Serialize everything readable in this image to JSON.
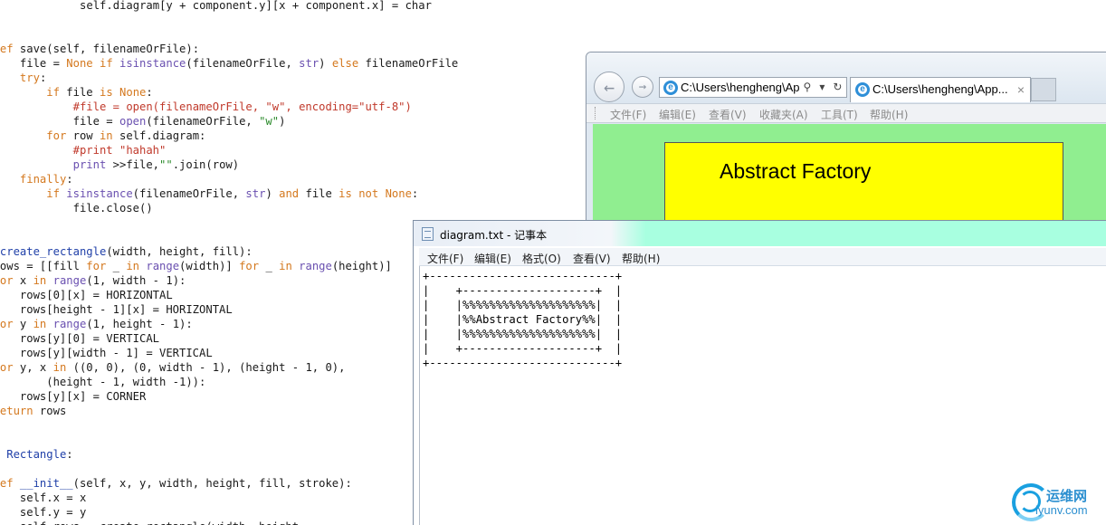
{
  "editor": {
    "lines": [
      {
        "row": 0,
        "col": 0,
        "tokens": [
          [
            "            self.diagram[y + component.y][x + component.x] = char",
            ""
          ]
        ]
      },
      {
        "row": 3,
        "col": -1,
        "tokens": [
          [
            "def",
            "tk-kw"
          ],
          [
            " save(self, filenameOrFile):",
            ""
          ]
        ]
      },
      {
        "row": 4,
        "col": -1,
        "tokens": [
          [
            "    file = ",
            ""
          ],
          [
            "None",
            "tk-kw"
          ],
          [
            " ",
            ""
          ],
          [
            "if",
            "tk-kw"
          ],
          [
            " ",
            ""
          ],
          [
            "isinstance",
            "tk-bi"
          ],
          [
            "(filenameOrFile, ",
            ""
          ],
          [
            "str",
            "tk-bi"
          ],
          [
            ") ",
            ""
          ],
          [
            "else",
            "tk-kw"
          ],
          [
            " filenameOrFile",
            ""
          ]
        ]
      },
      {
        "row": 5,
        "col": -1,
        "tokens": [
          [
            "    ",
            ""
          ],
          [
            "try",
            "tk-kw"
          ],
          [
            ":",
            ""
          ]
        ]
      },
      {
        "row": 6,
        "col": -1,
        "tokens": [
          [
            "        ",
            ""
          ],
          [
            "if",
            "tk-kw"
          ],
          [
            " file ",
            ""
          ],
          [
            "is",
            "tk-kw"
          ],
          [
            " ",
            ""
          ],
          [
            "None",
            "tk-kw"
          ],
          [
            ":",
            ""
          ]
        ]
      },
      {
        "row": 7,
        "col": -1,
        "tokens": [
          [
            "            ",
            ""
          ],
          [
            "#file = open(filenameOrFile, \"w\", encoding=\"utf-8\")",
            "tk-cm"
          ]
        ]
      },
      {
        "row": 8,
        "col": -1,
        "tokens": [
          [
            "            file = ",
            ""
          ],
          [
            "open",
            "tk-bi"
          ],
          [
            "(filenameOrFile, ",
            ""
          ],
          [
            "\"w\"",
            "tk-str"
          ],
          [
            ")",
            ""
          ]
        ]
      },
      {
        "row": 9,
        "col": -1,
        "tokens": [
          [
            "        ",
            ""
          ],
          [
            "for",
            "tk-kw"
          ],
          [
            " row ",
            ""
          ],
          [
            "in",
            "tk-kw"
          ],
          [
            " self.diagram:",
            ""
          ]
        ]
      },
      {
        "row": 10,
        "col": -1,
        "tokens": [
          [
            "            ",
            ""
          ],
          [
            "#print \"hahah\"",
            "tk-cm"
          ]
        ]
      },
      {
        "row": 11,
        "col": -1,
        "tokens": [
          [
            "            ",
            ""
          ],
          [
            "print",
            "tk-ph"
          ],
          [
            " >>file,",
            ""
          ],
          [
            "\"\"",
            "tk-str"
          ],
          [
            ".join(row)",
            ""
          ]
        ]
      },
      {
        "row": 12,
        "col": -1,
        "tokens": [
          [
            "    ",
            ""
          ],
          [
            "finally",
            "tk-kw"
          ],
          [
            ":",
            ""
          ]
        ]
      },
      {
        "row": 13,
        "col": -1,
        "tokens": [
          [
            "        ",
            ""
          ],
          [
            "if",
            "tk-kw"
          ],
          [
            " ",
            ""
          ],
          [
            "isinstance",
            "tk-bi"
          ],
          [
            "(filenameOrFile, ",
            ""
          ],
          [
            "str",
            "tk-bi"
          ],
          [
            ") ",
            ""
          ],
          [
            "and",
            "tk-kw"
          ],
          [
            " file ",
            ""
          ],
          [
            "is",
            "tk-kw"
          ],
          [
            " ",
            ""
          ],
          [
            "not",
            "tk-kw"
          ],
          [
            " ",
            ""
          ],
          [
            "None",
            "tk-kw"
          ],
          [
            ":",
            ""
          ]
        ]
      },
      {
        "row": 14,
        "col": -1,
        "tokens": [
          [
            "            file.close()",
            ""
          ]
        ]
      },
      {
        "row": 17,
        "col": -1,
        "tokens": [
          [
            " ",
            ""
          ],
          [
            "create_rectangle",
            "tk-def"
          ],
          [
            "(width, height, fill):",
            ""
          ]
        ]
      },
      {
        "row": 18,
        "col": -1,
        "tokens": [
          [
            "rows = [[fill ",
            ""
          ],
          [
            "for",
            "tk-kw"
          ],
          [
            " _ ",
            ""
          ],
          [
            "in",
            "tk-kw"
          ],
          [
            " ",
            ""
          ],
          [
            "range",
            "tk-bi"
          ],
          [
            "(width)] ",
            ""
          ],
          [
            "for",
            "tk-kw"
          ],
          [
            " _ ",
            ""
          ],
          [
            "in",
            "tk-kw"
          ],
          [
            " ",
            ""
          ],
          [
            "range",
            "tk-bi"
          ],
          [
            "(height)]",
            ""
          ]
        ]
      },
      {
        "row": 19,
        "col": -1,
        "tokens": [
          [
            "for",
            "tk-kw"
          ],
          [
            " x ",
            ""
          ],
          [
            "in",
            "tk-kw"
          ],
          [
            " ",
            ""
          ],
          [
            "range",
            "tk-bi"
          ],
          [
            "(1, width - 1):",
            ""
          ]
        ]
      },
      {
        "row": 20,
        "col": -1,
        "tokens": [
          [
            "    rows[0][x] = HORIZONTAL",
            ""
          ]
        ]
      },
      {
        "row": 21,
        "col": -1,
        "tokens": [
          [
            "    rows[height - 1][x] = HORIZONTAL",
            ""
          ]
        ]
      },
      {
        "row": 22,
        "col": -1,
        "tokens": [
          [
            "for",
            "tk-kw"
          ],
          [
            " y ",
            ""
          ],
          [
            "in",
            "tk-kw"
          ],
          [
            " ",
            ""
          ],
          [
            "range",
            "tk-bi"
          ],
          [
            "(1, height - 1):",
            ""
          ]
        ]
      },
      {
        "row": 23,
        "col": -1,
        "tokens": [
          [
            "    rows[y][0] = VERTICAL",
            ""
          ]
        ]
      },
      {
        "row": 24,
        "col": -1,
        "tokens": [
          [
            "    rows[y][width - 1] = VERTICAL",
            ""
          ]
        ]
      },
      {
        "row": 25,
        "col": -1,
        "tokens": [
          [
            "for",
            "tk-kw"
          ],
          [
            " y, x ",
            ""
          ],
          [
            "in",
            "tk-kw"
          ],
          [
            " ((0, 0), (0, width - 1), (height - 1, 0),",
            ""
          ]
        ]
      },
      {
        "row": 26,
        "col": -1,
        "tokens": [
          [
            "        (height - 1, width -1)):",
            ""
          ]
        ]
      },
      {
        "row": 27,
        "col": -1,
        "tokens": [
          [
            "    rows[y][x] = CORNER",
            ""
          ]
        ]
      },
      {
        "row": 28,
        "col": -1,
        "tokens": [
          [
            "return",
            "tk-kw"
          ],
          [
            " rows",
            ""
          ]
        ]
      },
      {
        "row": 31,
        "col": -1,
        "tokens": [
          [
            "  ",
            ""
          ],
          [
            "Rectangle",
            "tk-cls"
          ],
          [
            ":",
            ""
          ]
        ]
      },
      {
        "row": 33,
        "col": -1,
        "tokens": [
          [
            "def",
            "tk-kw"
          ],
          [
            " ",
            ""
          ],
          [
            "__init__",
            "tk-def"
          ],
          [
            "(self, x, y, width, height, fill, stroke):",
            ""
          ]
        ]
      },
      {
        "row": 34,
        "col": -1,
        "tokens": [
          [
            "    self.x = x",
            ""
          ]
        ]
      },
      {
        "row": 35,
        "col": -1,
        "tokens": [
          [
            "    self.y = y",
            ""
          ]
        ]
      },
      {
        "row": 36,
        "col": -1,
        "tokens": [
          [
            "    self.rows = create_rectangle(width, height,",
            ""
          ]
        ]
      }
    ]
  },
  "browser": {
    "address": "C:\\Users\\hengheng\\Ap",
    "tab_title": "C:\\Users\\hengheng\\App...",
    "tab_close": "×",
    "back_icon": "back-arrow",
    "forward_icon": "forward-arrow",
    "menu": [
      "文件(F)",
      "编辑(E)",
      "查看(V)",
      "收藏夹(A)",
      "工具(T)",
      "帮助(H)"
    ],
    "content_background": "#90ee90",
    "box_fill": "#ffff00",
    "box_text": "Abstract Factory"
  },
  "notepad": {
    "title": "diagram.txt - 记事本",
    "menu": [
      "文件(F)",
      "编辑(E)",
      "格式(O)",
      "查看(V)",
      "帮助(H)"
    ],
    "text_lines": [
      "+----------------------------+",
      "|    +--------------------+  |",
      "|    |%%%%%%%%%%%%%%%%%%%%|  |",
      "|    |%%Abstract Factory%%|  |",
      "|    |%%%%%%%%%%%%%%%%%%%%|  |",
      "|    +--------------------+  |",
      "+----------------------------+"
    ]
  },
  "watermark": {
    "cn": "运维网",
    "en": "iyunv.com"
  }
}
